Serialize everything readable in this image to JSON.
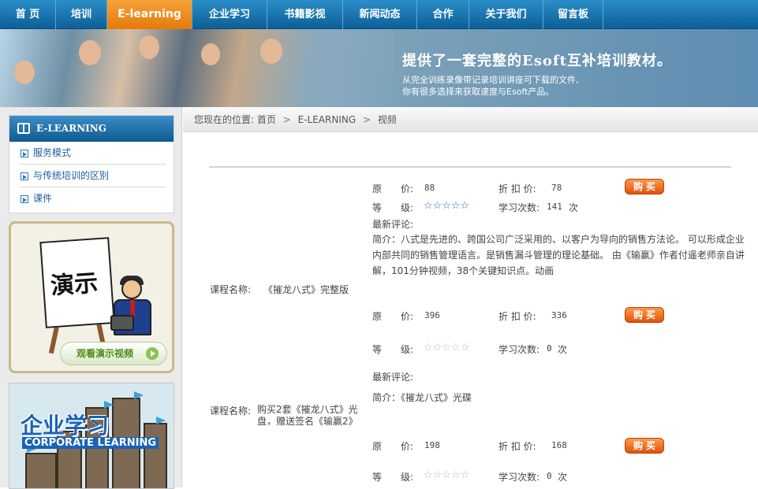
{
  "nav": {
    "items": [
      "首 页",
      "培训",
      "E-learning",
      "企业学习",
      "书籍影视",
      "新闻动态",
      "合作",
      "关于我们",
      "留言板"
    ],
    "active": "E-learning"
  },
  "banner": {
    "title": "提供了一套完整的Esoft互补培训教材。",
    "line1": "从完全训练录像带记录培训讲座可下载的文件,",
    "line2": "你有很多选择来获取速度与Esoft产品。"
  },
  "sidebar": {
    "heading": "E-LEARNING",
    "links": [
      "服务模式",
      "与传统培训的区别",
      "课件"
    ],
    "demo": {
      "board_text": "演示",
      "button": "观看演示视频"
    },
    "corp": {
      "title": "企业学习",
      "subtitle": "CORPORATE LEARNING"
    }
  },
  "breadcrumb": {
    "prefix": "您现在的位置:",
    "items": [
      "首页",
      "E-LEARNING",
      "视频"
    ],
    "separator": ">"
  },
  "labels": {
    "orig_price": "原　　价:",
    "discount_price": "折 扣 价:",
    "level": "等　　级:",
    "study_count": "学习次数:",
    "latest_review": "最新评论:",
    "course_name": "课程名称:",
    "buy": "购买",
    "times_unit": "次",
    "star_glyphs": "☆☆☆☆☆"
  },
  "courses": [
    {
      "orig_price": "88",
      "discount_price": "78",
      "study_count": "141",
      "stars_filled": true,
      "intro": "简介：八式是先进的、跨国公司广泛采用的、以客户为导向的销售方法论。 可以形成企业内部共同的销售管理语言。是销售漏斗管理的理论基础。 由《输赢》作者付遥老师亲自讲解，101分钟视频，38个关键知识点。动画",
      "name": "《摧龙八式》完整版"
    },
    {
      "orig_price": "396",
      "discount_price": "336",
      "study_count": "0",
      "stars_filled": false,
      "intro": "简介：《摧龙八式》光碟",
      "name": "购买2套《摧龙八式》光盘，赠送签名《输赢2》"
    },
    {
      "orig_price": "198",
      "discount_price": "168",
      "study_count": "0",
      "stars_filled": false,
      "intro": "",
      "name": ""
    }
  ]
}
